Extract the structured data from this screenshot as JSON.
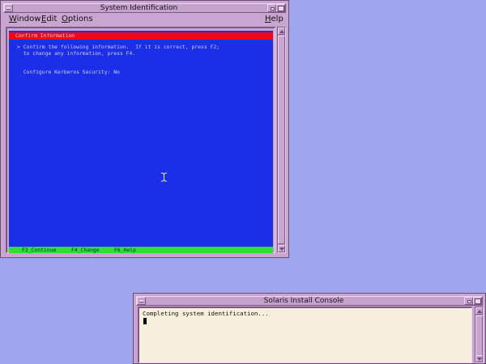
{
  "desktop": {
    "background_color": "#a0a6ee"
  },
  "sysid_window": {
    "title": "System Identification",
    "menus": {
      "window": {
        "mnemonic": "W",
        "rest": "indow"
      },
      "edit": {
        "mnemonic": "E",
        "rest": "dit"
      },
      "options": {
        "mnemonic": "O",
        "rest": "ptions"
      },
      "help": {
        "mnemonic": "H",
        "rest": "elp"
      }
    },
    "terminal": {
      "header": "Confirm Information",
      "line1": "> Confirm the following information.  If it is correct, press F2;",
      "line2": "  to change any information, press F4.",
      "setting": "  Configure Kerberos Security: No",
      "footer": {
        "f2": "F2_Continue",
        "f4": "F4_Change",
        "f6": "F6_Help"
      }
    },
    "colors": {
      "terminal_bg": "#1b2ee8",
      "header_bg": "#f00818",
      "footer_bg": "#30e030"
    }
  },
  "console_window": {
    "title": "Solaris Install Console",
    "output": "Completing system identification..."
  }
}
